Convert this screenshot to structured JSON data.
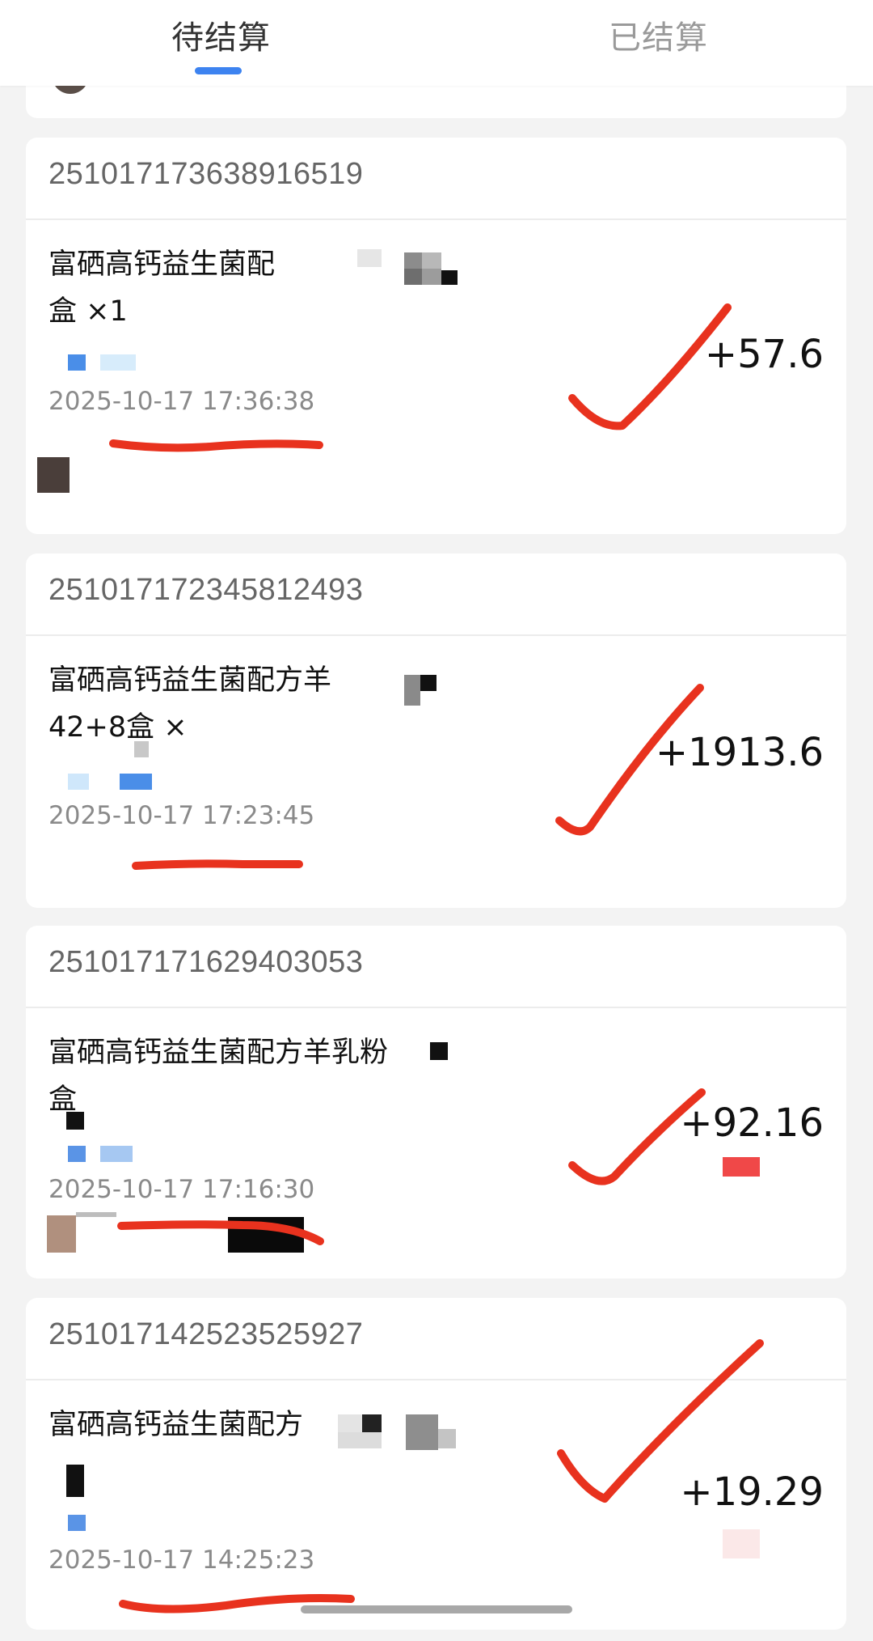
{
  "tabs": [
    {
      "label": "待结算",
      "active": true
    },
    {
      "label": "已结算",
      "active": false
    }
  ],
  "orders": [
    {
      "order_no": "251017173638916519",
      "product_line1": "富硒高钙益生菌配",
      "product_line2": "盒 ×1",
      "time": "2025-10-17 17:36:38",
      "amount": "+57.6"
    },
    {
      "order_no": "251017172345812493",
      "product_line1": "富硒高钙益生菌配方羊",
      "product_line2": "42+8盒 ×",
      "time": "2025-10-17 17:23:45",
      "amount": "+1913.6"
    },
    {
      "order_no": "251017171629403053",
      "product_line1": "富硒高钙益生菌配方羊乳粉",
      "product_line2": "盒",
      "time": "2025-10-17 17:16:30",
      "amount": "+92.16"
    },
    {
      "order_no": "251017142523525927",
      "product_line1": "富硒高钙益生菌配方",
      "product_line2": "",
      "time": "2025-10-17 14:25:23",
      "amount": "+19.29"
    }
  ],
  "colors": {
    "accent": "#3d83f0",
    "annotation_red": "#e8321e",
    "time_gray": "#8a8a8a"
  },
  "icons": {
    "checkmark": "hand-drawn-checkmark-icon",
    "underline": "hand-drawn-underline"
  }
}
